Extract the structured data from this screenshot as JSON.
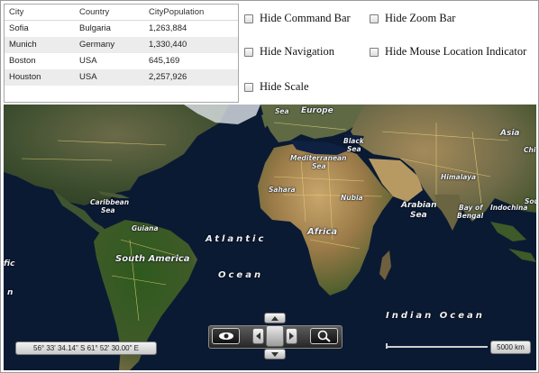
{
  "grid": {
    "columns": [
      "City",
      "Country",
      "CityPopulation"
    ],
    "rows": [
      [
        "Sofia",
        "Bulgaria",
        "1,263,884"
      ],
      [
        "Munich",
        "Germany",
        "1,330,440"
      ],
      [
        "Boston",
        "USA",
        "645,169"
      ],
      [
        "Houston",
        "USA",
        "2,257,926"
      ]
    ]
  },
  "options": {
    "hide_command_bar": "Hide Command Bar",
    "hide_zoom_bar": "Hide Zoom Bar",
    "hide_navigation": "Hide Navigation",
    "hide_mouse_location": "Hide Mouse Location Indicator",
    "hide_scale": "Hide Scale"
  },
  "map": {
    "labels": {
      "sea_top": "Sea",
      "europe": "Europe",
      "asia": "Asia",
      "black_sea_1": "Black",
      "black_sea_2": "Sea",
      "mediterranean_1": "Mediterranean",
      "mediterranean_2": "Sea",
      "sahara": "Sahara",
      "himalaya": "Himalaya",
      "nubia": "Nubia",
      "arabian_sea_1": "Arabian",
      "arabian_sea_2": "Sea",
      "bay_bengal_1": "Bay of",
      "bay_bengal_2": "Bengal",
      "indochina": "Indochina",
      "caribbean_1": "Caribbean",
      "caribbean_2": "Sea",
      "guiana": "Guiana",
      "atlantic": "Atlantic",
      "ocean_atl": "Ocean",
      "africa": "Africa",
      "south_america": "South America",
      "indian_ocean": "Indian Ocean",
      "pacific_part": "fic",
      "pacific_ocean_part": "n",
      "china_part": "Chi",
      "sou_part": "Sou"
    },
    "mouse_location": "56° 33' 34.14\" S 61° 52' 30.00\" E",
    "scale_label": "5000 km",
    "icons": [
      "eye-icon",
      "pan-up-icon",
      "pan-down-icon",
      "pan-left-icon",
      "pan-right-icon",
      "magnifier-icon"
    ]
  }
}
